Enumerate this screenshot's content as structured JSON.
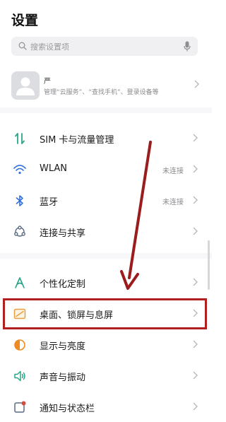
{
  "header": {
    "title": "设置"
  },
  "search": {
    "placeholder": "搜索设置项"
  },
  "account": {
    "name": "严",
    "description": "管理“云服务”、“查找手机”、登录设备等"
  },
  "menu": [
    {
      "label": "SIM 卡与流量管理",
      "value": "",
      "icon": "sim-data-icon"
    },
    {
      "label": "WLAN",
      "value": "未连接",
      "icon": "wifi-icon"
    },
    {
      "label": "蓝牙",
      "value": "未连接",
      "icon": "bluetooth-icon"
    },
    {
      "label": "连接与共享",
      "value": "",
      "icon": "share-icon"
    },
    {
      "label": "个性化定制",
      "value": "",
      "icon": "personalize-icon"
    },
    {
      "label": "桌面、锁屏与息屏",
      "value": "",
      "icon": "wallpaper-icon"
    },
    {
      "label": "显示与亮度",
      "value": "",
      "icon": "brightness-icon"
    },
    {
      "label": "声音与振动",
      "value": "",
      "icon": "sound-icon"
    },
    {
      "label": "通知与状态栏",
      "value": "",
      "icon": "notification-icon"
    }
  ],
  "colors": {
    "highlight_border": "#b02020",
    "annotation_arrow": "#9a1c1c",
    "sim_icon": "#2aa58a",
    "wifi_icon": "#2f6fe0",
    "bluetooth_icon": "#2f6fe0",
    "share_icon": "#5a6b86",
    "personalize_icon": "#2aa58a",
    "wallpaper_icon": "#e8a03c",
    "brightness_icon": "#f08a20",
    "sound_icon": "#2aa58a",
    "notification_icon": "#d84a3a"
  }
}
